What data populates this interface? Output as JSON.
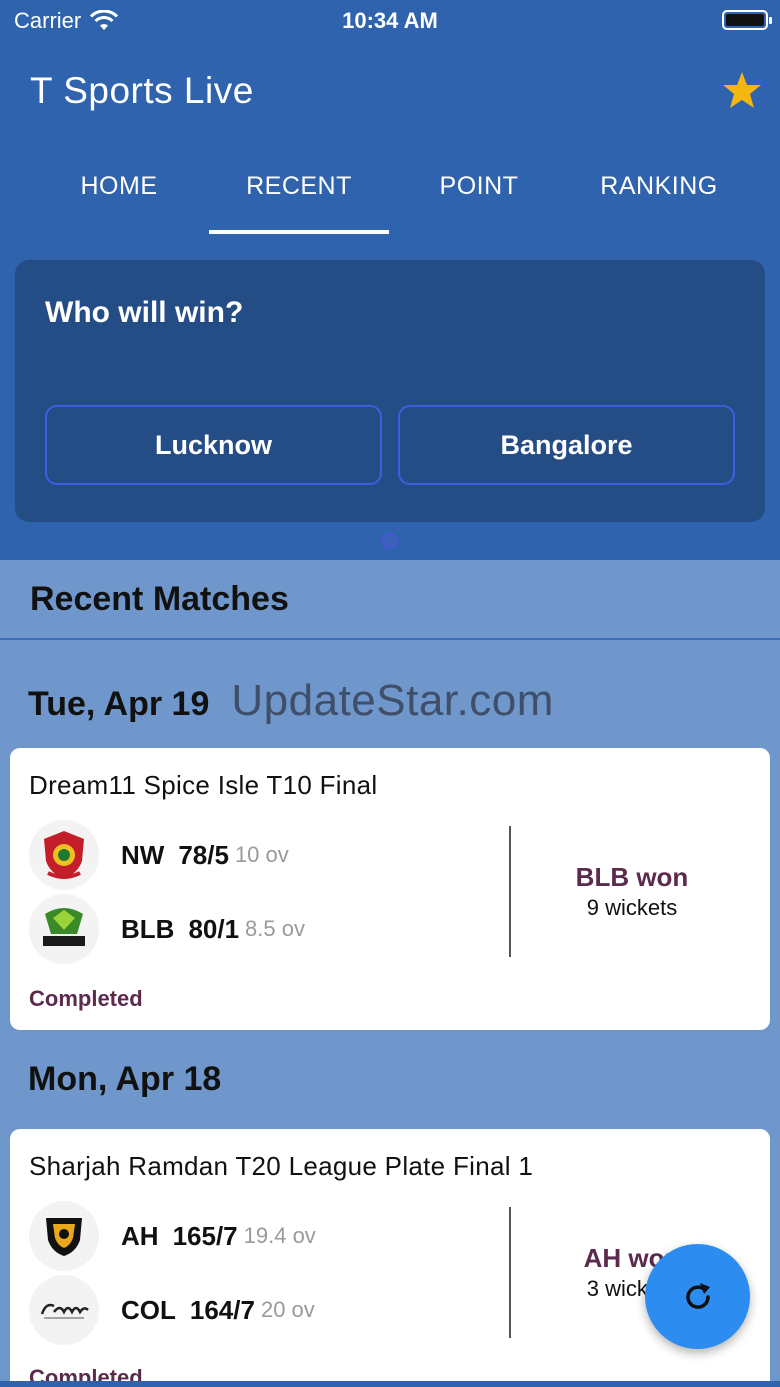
{
  "status_bar": {
    "carrier": "Carrier",
    "time": "10:34 AM"
  },
  "app": {
    "title": "T Sports Live"
  },
  "tabs": [
    {
      "label": "HOME",
      "active": false
    },
    {
      "label": "RECENT",
      "active": true
    },
    {
      "label": "POINT",
      "active": false
    },
    {
      "label": "RANKING",
      "active": false
    }
  ],
  "poll": {
    "question": "Who will win?",
    "option_a": "Lucknow",
    "option_b": "Bangalore"
  },
  "section": {
    "title": "Recent Matches"
  },
  "watermark": "UpdateStar.com",
  "groups": [
    {
      "date": "Tue, Apr 19",
      "match": {
        "title": "Dream11 Spice Isle T10 Final",
        "team1": {
          "abbr": "NW",
          "score": "78/5",
          "overs": "10 ov"
        },
        "team2": {
          "abbr": "BLB",
          "score": "80/1",
          "overs": "8.5 ov"
        },
        "result_title": "BLB won",
        "result_detail": "9 wickets",
        "status": "Completed"
      }
    },
    {
      "date": "Mon, Apr 18",
      "match": {
        "title": "Sharjah Ramdan T20 League Plate Final 1",
        "team1": {
          "abbr": "AH",
          "score": "165/7",
          "overs": "19.4 ov"
        },
        "team2": {
          "abbr": "COL",
          "score": "164/7",
          "overs": "20 ov"
        },
        "result_title": "AH won",
        "result_detail": "3 wickets",
        "status": "Completed"
      }
    }
  ],
  "colors": {
    "primary": "#2f63ad",
    "poll_card": "#244d86",
    "background": "#6f97cb",
    "accent_text": "#5b2a4d",
    "fab": "#2d8cf0",
    "star": "#f5b70f"
  },
  "icons": {
    "status": [
      "wifi-icon",
      "battery-icon"
    ],
    "app_bar": "star-icon",
    "fab": "refresh-icon"
  }
}
